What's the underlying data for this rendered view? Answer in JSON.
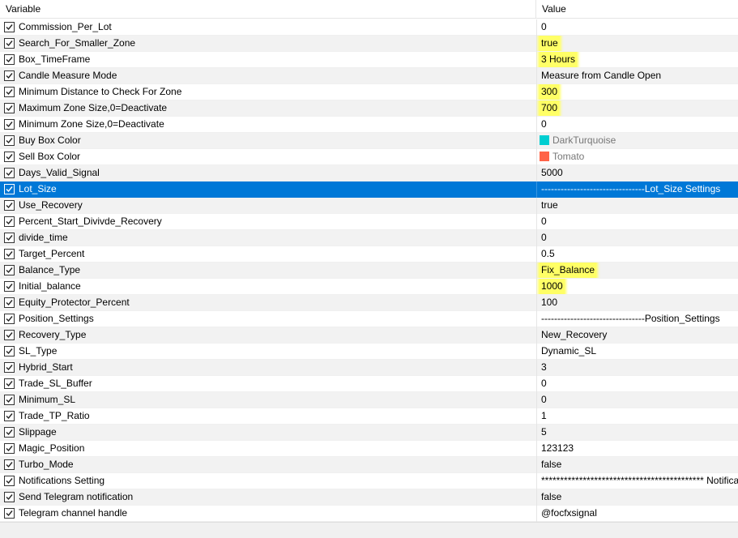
{
  "header": {
    "variable": "Variable",
    "value": "Value"
  },
  "rows": [
    {
      "name": "Commission_Per_Lot",
      "value": "0"
    },
    {
      "name": "Search_For_Smaller_Zone",
      "value": "true",
      "highlight": true
    },
    {
      "name": "Box_TimeFrame",
      "value": "3 Hours",
      "highlight": true
    },
    {
      "name": "Candle Measure Mode",
      "value": "Measure from Candle Open"
    },
    {
      "name": "Minimum Distance to Check For Zone",
      "value": "300",
      "highlight": true
    },
    {
      "name": "Maximum Zone Size,0=Deactivate",
      "value": "700",
      "highlight": true
    },
    {
      "name": "Minimum Zone Size,0=Deactivate",
      "value": "0"
    },
    {
      "name": "Buy Box Color",
      "value": "DarkTurquoise",
      "swatch": "#00ced1"
    },
    {
      "name": "Sell Box Color",
      "value": "Tomato",
      "swatch": "#ff6347"
    },
    {
      "name": "Days_Valid_Signal",
      "value": "5000"
    },
    {
      "name": "Lot_Size",
      "value": "--------------------------------Lot_Size Settings",
      "selected": true
    },
    {
      "name": "Use_Recovery",
      "value": "true"
    },
    {
      "name": "Percent_Start_Divivde_Recovery",
      "value": "0"
    },
    {
      "name": "divide_time",
      "value": "0"
    },
    {
      "name": "Target_Percent",
      "value": "0.5"
    },
    {
      "name": "Balance_Type",
      "value": "Fix_Balance",
      "highlight": true
    },
    {
      "name": "Initial_balance",
      "value": "1000",
      "highlight": true
    },
    {
      "name": "Equity_Protector_Percent",
      "value": "100"
    },
    {
      "name": "Position_Settings",
      "value": "--------------------------------Position_Settings"
    },
    {
      "name": "Recovery_Type",
      "value": "New_Recovery"
    },
    {
      "name": "SL_Type",
      "value": "Dynamic_SL"
    },
    {
      "name": "Hybrid_Start",
      "value": "3"
    },
    {
      "name": "Trade_SL_Buffer",
      "value": "0"
    },
    {
      "name": "Minimum_SL",
      "value": "0"
    },
    {
      "name": "Trade_TP_Ratio",
      "value": "1"
    },
    {
      "name": "Slippage",
      "value": "5"
    },
    {
      "name": "Magic_Position",
      "value": "123123"
    },
    {
      "name": "Turbo_Mode",
      "value": "false"
    },
    {
      "name": "Notifications Setting",
      "value": "******************************************* Notifications"
    },
    {
      "name": "Send Telegram notification",
      "value": "false"
    },
    {
      "name": "Telegram channel handle",
      "value": "@focfxsignal"
    }
  ],
  "colors": {
    "selected": "#0078d7",
    "highlight": "#ffff66",
    "alt_row": "#f2f2f2"
  },
  "icons": {
    "checkbox": "checkbox-checked-icon"
  }
}
